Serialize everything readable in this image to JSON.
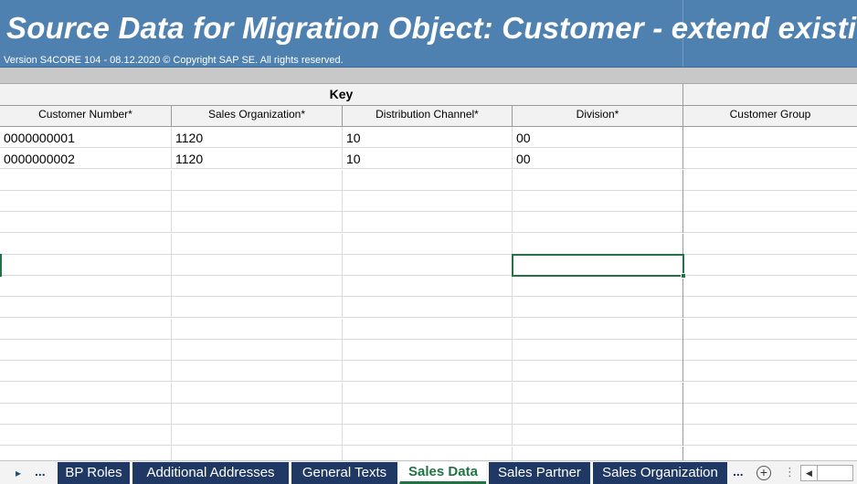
{
  "sheet": {
    "title": "Source Data for Migration Object:  Customer - extend existing record by new org levels",
    "version": "Version S4CORE 104  - 08.12.2020 © Copyright SAP SE. All rights reserved.",
    "key_group": "Key",
    "columns": [
      "Customer Number*",
      "Sales Organization*",
      "Distribution Channel*",
      "Division*",
      "Customer Group"
    ],
    "rows": [
      [
        "0000000001",
        "1120",
        "10",
        "00",
        ""
      ],
      [
        "0000000002",
        "1120",
        "10",
        "00",
        ""
      ]
    ]
  },
  "tabs": {
    "nav_next_icon": "triangle-right-icon",
    "overflow_left": "...",
    "items": [
      "BP Roles",
      "Additional Addresses",
      "General Texts",
      "Sales Data",
      "Sales Partner",
      "Sales Organization"
    ],
    "active": "Sales Data",
    "overflow_right": "...",
    "add_icon": "⊕"
  },
  "colors": {
    "banner": "#4f81b0",
    "tab_bg": "#1f3864",
    "active_tab_text": "#217346",
    "selection": "#217346"
  }
}
